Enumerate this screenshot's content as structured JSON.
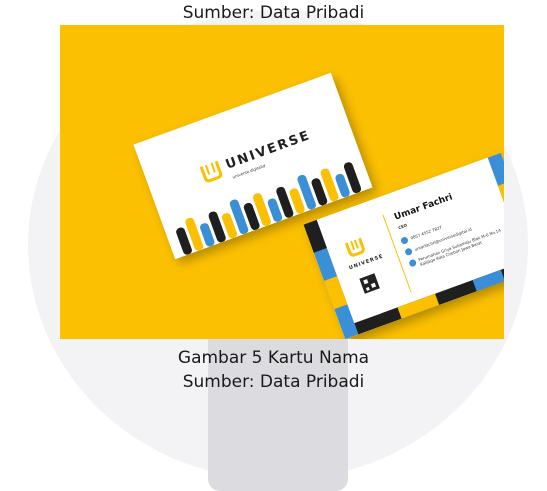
{
  "caption_top": "Sumber: Data Pribadi",
  "figure_caption": "Gambar 5 Kartu Nama",
  "figure_source": "Sumber: Data Pribadi",
  "card_front": {
    "logo_word": "UNIVERSE",
    "website": "universe.digitalid"
  },
  "card_back": {
    "name": "Umar Fachri",
    "role": "CEO",
    "phone": "0857 4552 7827",
    "email": "umarfachri@universedigital.id",
    "address": "Perumahan Griya Sukamaju Blok M-6 No.14 Kalijaga Kota Cirebon Jawa Barat",
    "logo_word": "UNIVERSE"
  },
  "colors": {
    "background": "#fcc002",
    "accent_blue": "#3a8fd6",
    "accent_dark": "#1f1f1f",
    "accent_yellow": "#fcc002"
  }
}
